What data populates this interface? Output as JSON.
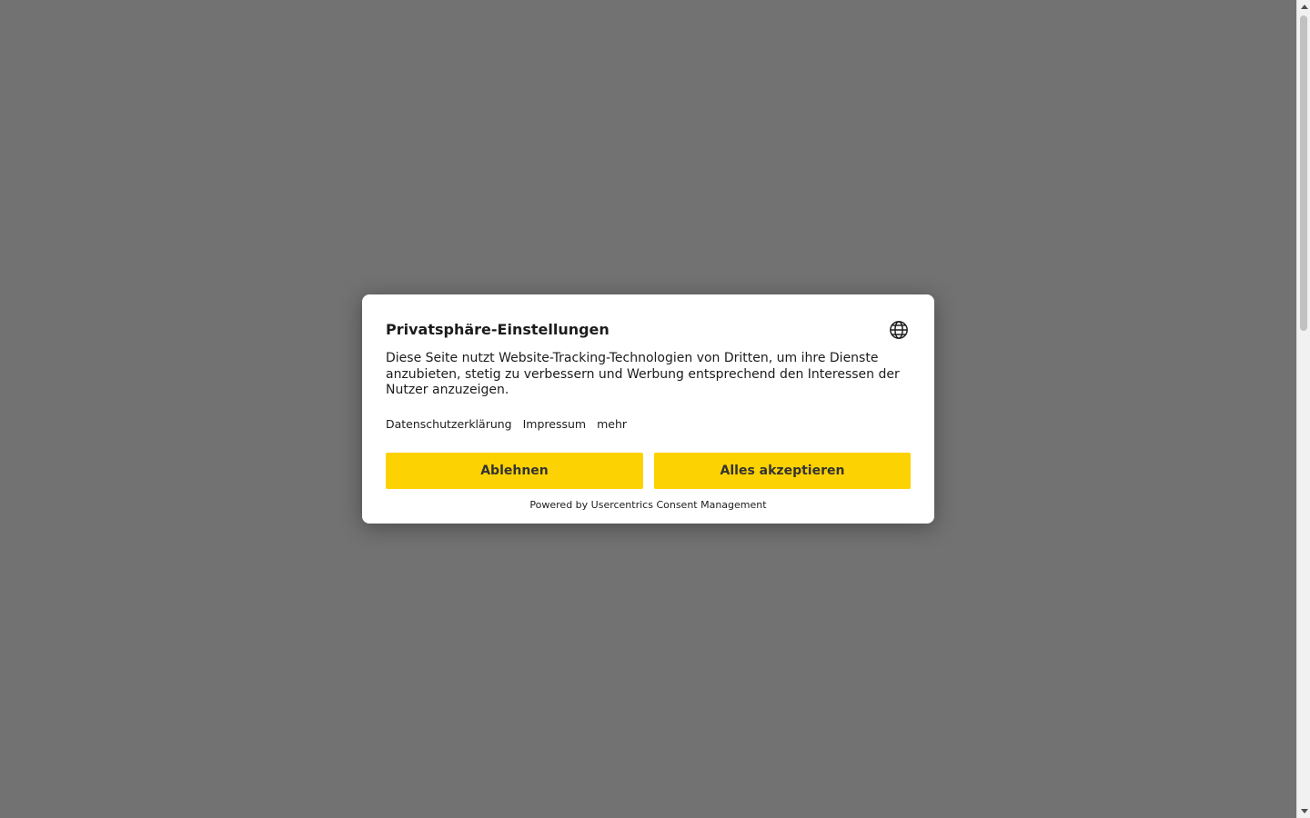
{
  "dialog": {
    "title": "Privatsphäre-Einstellungen",
    "language_icon": "globe-icon",
    "description": "Diese Seite nutzt Website-Tracking-Technologien von Dritten, um ihre Dienste anzubieten, stetig zu verbessern und Werbung entsprechend den Interessen der Nutzer anzuzeigen.",
    "links": {
      "privacy": "Datenschutzerklärung",
      "imprint": "Impressum",
      "more": "mehr"
    },
    "buttons": {
      "deny": "Ablehnen",
      "accept": "Alles akzeptieren"
    },
    "powered_by": "Powered by Usercentrics Consent Management"
  },
  "colors": {
    "overlay": "#727272",
    "button": "#fdd202",
    "button_text": "#333333",
    "dialog_bg": "#ffffff"
  }
}
